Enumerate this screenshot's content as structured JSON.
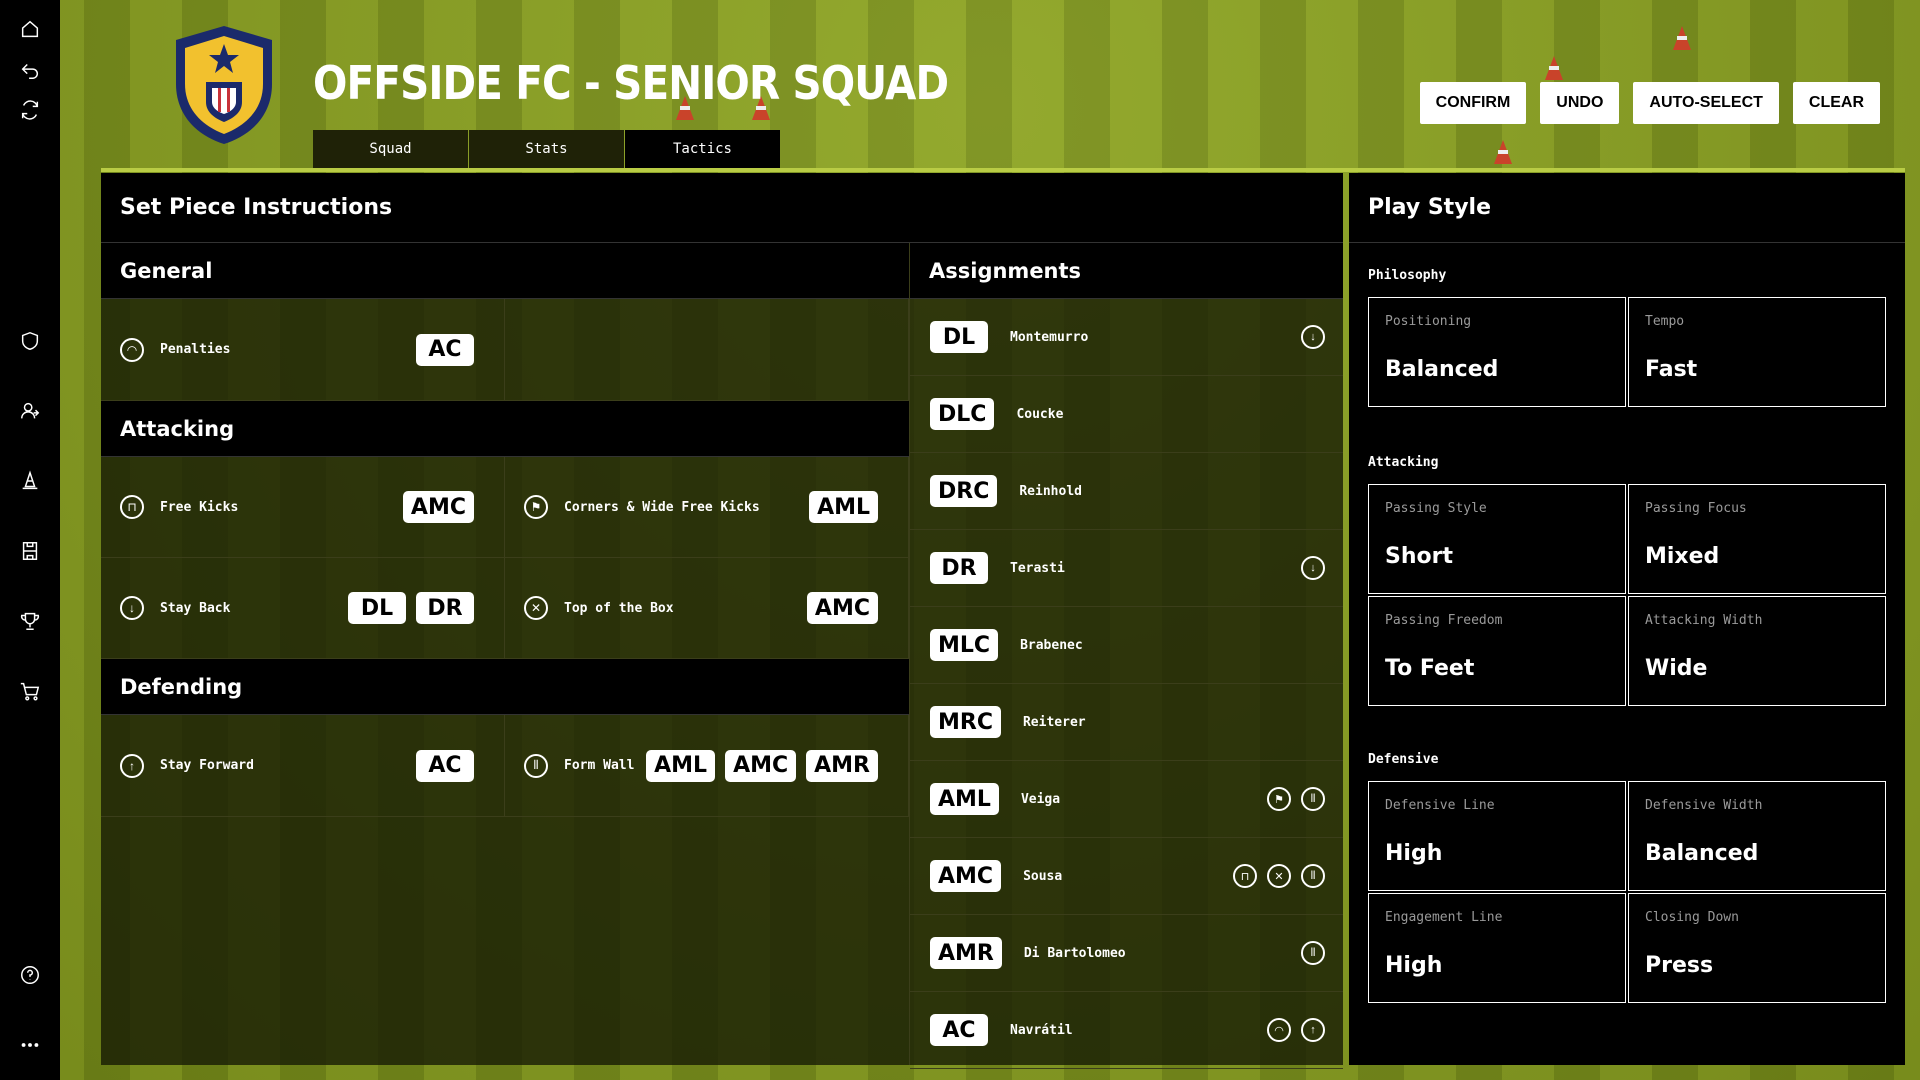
{
  "header": {
    "title": "OFFSIDE FC - SENIOR SQUAD",
    "tabs": [
      {
        "label": "Squad",
        "active": false
      },
      {
        "label": "Stats",
        "active": false
      },
      {
        "label": "Tactics",
        "active": true
      }
    ],
    "buttons": {
      "confirm": "CONFIRM",
      "undo": "UNDO",
      "auto_select": "AUTO-SELECT",
      "clear": "CLEAR"
    }
  },
  "sidebar": {
    "items": [
      "home-icon",
      "undo-icon",
      "refresh-icon",
      "shield-icon",
      "users-icon",
      "cone-icon",
      "pitch-icon",
      "trophy-icon",
      "cart-icon",
      "help-icon",
      "more-icon"
    ]
  },
  "set_piece": {
    "title": "Set Piece Instructions",
    "general": {
      "title": "General",
      "penalties": {
        "label": "Penalties",
        "tags": [
          "AC"
        ]
      }
    },
    "attacking": {
      "title": "Attacking",
      "free_kicks": {
        "label": "Free Kicks",
        "tags": [
          "AMC"
        ]
      },
      "corners": {
        "label": "Corners & Wide Free Kicks",
        "tags": [
          "AML"
        ]
      },
      "stay_back": {
        "label": "Stay Back",
        "tags": [
          "DL",
          "DR"
        ]
      },
      "top_box": {
        "label": "Top of the Box",
        "tags": [
          "AMC"
        ]
      }
    },
    "defending": {
      "title": "Defending",
      "stay_forward": {
        "label": "Stay Forward",
        "tags": [
          "AC"
        ]
      },
      "form_wall": {
        "label": "Form Wall",
        "tags": [
          "AML",
          "AMC",
          "AMR"
        ]
      }
    }
  },
  "assignments": {
    "title": "Assignments",
    "rows": [
      {
        "pos": "DL",
        "name": "Montemurro",
        "icons": [
          "stay-back-icon"
        ]
      },
      {
        "pos": "DLC",
        "name": "Coucke",
        "icons": []
      },
      {
        "pos": "DRC",
        "name": "Reinhold",
        "icons": []
      },
      {
        "pos": "DR",
        "name": "Terasti",
        "icons": [
          "stay-back-icon"
        ]
      },
      {
        "pos": "MLC",
        "name": "Brabenec",
        "icons": []
      },
      {
        "pos": "MRC",
        "name": "Reiterer",
        "icons": []
      },
      {
        "pos": "AML",
        "name": "Veiga",
        "icons": [
          "corner-icon",
          "wall-icon"
        ]
      },
      {
        "pos": "AMC",
        "name": "Sousa",
        "icons": [
          "free-kick-icon",
          "top-box-icon",
          "wall-icon"
        ]
      },
      {
        "pos": "AMR",
        "name": "Di Bartolomeo",
        "icons": [
          "wall-icon"
        ]
      },
      {
        "pos": "AC",
        "name": "Navrátil",
        "icons": [
          "penalty-icon",
          "stay-forward-icon"
        ]
      }
    ]
  },
  "play_style": {
    "title": "Play Style",
    "philosophy": {
      "title": "Philosophy",
      "items": [
        {
          "label": "Positioning",
          "value": "Balanced"
        },
        {
          "label": "Tempo",
          "value": "Fast"
        }
      ]
    },
    "attacking": {
      "title": "Attacking",
      "items": [
        {
          "label": "Passing Style",
          "value": "Short"
        },
        {
          "label": "Passing Focus",
          "value": "Mixed"
        },
        {
          "label": "Passing Freedom",
          "value": "To Feet"
        },
        {
          "label": "Attacking Width",
          "value": "Wide"
        }
      ]
    },
    "defensive": {
      "title": "Defensive",
      "items": [
        {
          "label": "Defensive Line",
          "value": "High"
        },
        {
          "label": "Defensive Width",
          "value": "Balanced"
        },
        {
          "label": "Engagement Line",
          "value": "High"
        },
        {
          "label": "Closing Down",
          "value": "Press"
        }
      ]
    }
  }
}
